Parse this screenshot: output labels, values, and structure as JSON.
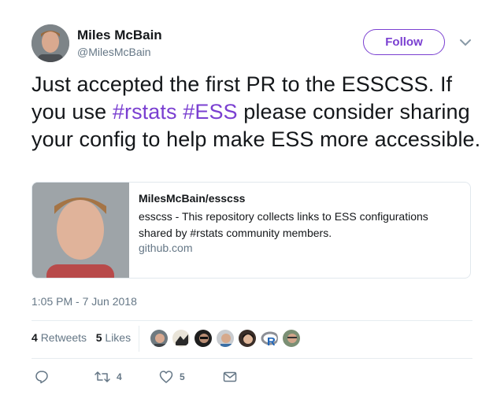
{
  "author": {
    "name": "Miles McBain",
    "handle": "@MilesMcBain",
    "avatar_icon": "profile-photo"
  },
  "follow_label": "Follow",
  "menu_icon": "chevron-down-icon",
  "tweet": {
    "text_1": "Just accepted the first PR to the ESSCSS. If you use ",
    "tag_1": "#rstats",
    "space": " ",
    "tag_2": "#ESS",
    "text_2": " please consider sharing your config to help make ESS more accessible."
  },
  "card": {
    "title": "MilesMcBain/esscss",
    "description": "esscss - This repository collects links to ESS configurations shared by #rstats community members.",
    "domain": "github.com"
  },
  "timestamp": "1:05 PM - 7 Jun 2018",
  "stats": {
    "retweets_count": "4",
    "retweets_label": "Retweets",
    "likes_count": "5",
    "likes_label": "Likes"
  },
  "actions": {
    "reply_icon": "reply-icon",
    "retweet_icon": "retweet-icon",
    "retweet_count": "4",
    "like_icon": "heart-icon",
    "like_count": "5",
    "dm_icon": "envelope-icon"
  },
  "colors": {
    "accent": "#7a3fd1",
    "secondary_text": "#657786",
    "border": "#e1e8ed"
  }
}
